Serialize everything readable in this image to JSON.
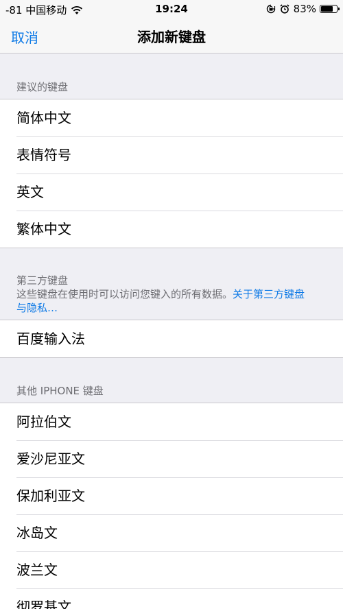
{
  "status_bar": {
    "carrier": "-81 中国移动",
    "time": "19:24",
    "battery": "83%",
    "battery_level": 0.83
  },
  "nav": {
    "cancel": "取消",
    "title": "添加新键盘"
  },
  "suggested": {
    "header": "建议的键盘",
    "items": [
      "简体中文",
      "表情符号",
      "英文",
      "繁体中文"
    ]
  },
  "third_party": {
    "header": "第三方键盘",
    "description": "这些键盘在使用时可以访问您键入的所有数据。",
    "link_line1": "关于第三方键盘",
    "link_line2": "与隐私…",
    "items": [
      "百度输入法"
    ]
  },
  "other": {
    "header": "其他 IPHONE 键盘",
    "items": [
      "阿拉伯文",
      "爱沙尼亚文",
      "保加利亚文",
      "冰岛文",
      "波兰文",
      "彻罗基文"
    ]
  },
  "icons": {
    "wifi": "wifi-icon",
    "orientation_lock": "orientation-lock-icon",
    "alarm": "alarm-icon",
    "battery": "battery-icon"
  }
}
